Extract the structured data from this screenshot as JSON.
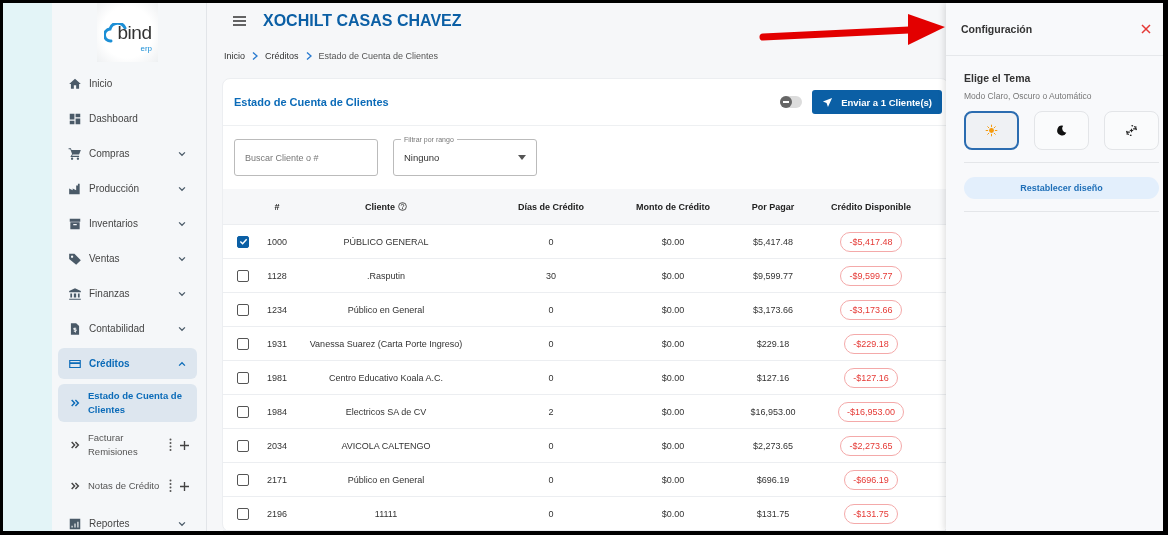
{
  "logo": {
    "name": "bind",
    "suffix": "erp"
  },
  "sidebar": {
    "items": [
      {
        "label": "Inicio",
        "kind": "link",
        "selected": false
      },
      {
        "label": "Dashboard",
        "kind": "link",
        "selected": false
      },
      {
        "label": "Compras",
        "kind": "group",
        "expanded": false,
        "selected": false
      },
      {
        "label": "Producción",
        "kind": "group",
        "expanded": false,
        "selected": false
      },
      {
        "label": "Inventarios",
        "kind": "group",
        "expanded": false,
        "selected": false
      },
      {
        "label": "Ventas",
        "kind": "group",
        "expanded": false,
        "selected": false
      },
      {
        "label": "Finanzas",
        "kind": "group",
        "expanded": false,
        "selected": false
      },
      {
        "label": "Contabilidad",
        "kind": "group",
        "expanded": false,
        "selected": false
      },
      {
        "label": "Créditos",
        "kind": "group",
        "expanded": true,
        "selected": true,
        "children": [
          {
            "label": "Estado de Cuenta de Clientes",
            "selected": true,
            "has_actions": false
          },
          {
            "label": "Facturar Remisiones",
            "selected": false,
            "has_actions": true
          },
          {
            "label": "Notas de Crédito",
            "selected": false,
            "has_actions": true
          }
        ]
      },
      {
        "label": "Reportes",
        "kind": "group",
        "expanded": false,
        "selected": false
      }
    ]
  },
  "header": {
    "title": "XOCHILT CASAS CHAVEZ"
  },
  "breadcrumb": [
    "Inicio",
    "Créditos",
    "Estado de Cuenta de Clientes"
  ],
  "card": {
    "title": "Estado de Cuenta de Clientes",
    "toggle": {
      "on": false
    },
    "send_button": "Enviar a 1 Cliente(s)",
    "search": {
      "placeholder": "Buscar Cliente o #"
    },
    "filter": {
      "label": "Filtrar por rango",
      "value": "Ninguno"
    }
  },
  "table": {
    "columns": [
      {
        "label": "#",
        "help": false
      },
      {
        "label": "Cliente",
        "help": true
      },
      {
        "label": "Días de Crédito",
        "help": false
      },
      {
        "label": "Monto de Crédito",
        "help": false
      },
      {
        "label": "Por Pagar",
        "help": false
      },
      {
        "label": "Crédito Disponible",
        "help": false
      }
    ],
    "rows": [
      {
        "checked": true,
        "cells": [
          "1000",
          "PÚBLICO GENERAL",
          "0",
          "$0.00",
          "$5,417.48",
          "-$5,417.48"
        ]
      },
      {
        "checked": false,
        "cells": [
          "1128",
          ".Rasputin",
          "30",
          "$0.00",
          "$9,599.77",
          "-$9,599.77"
        ]
      },
      {
        "checked": false,
        "cells": [
          "1234",
          "Público en General",
          "0",
          "$0.00",
          "$3,173.66",
          "-$3,173.66"
        ]
      },
      {
        "checked": false,
        "cells": [
          "1931",
          "Vanessa Suarez (Carta Porte Ingreso)",
          "0",
          "$0.00",
          "$229.18",
          "-$229.18"
        ]
      },
      {
        "checked": false,
        "cells": [
          "1981",
          "Centro Educativo Koala A.C.",
          "0",
          "$0.00",
          "$127.16",
          "-$127.16"
        ]
      },
      {
        "checked": false,
        "cells": [
          "1984",
          "Electricos SA de CV",
          "2",
          "$0.00",
          "$16,953.00",
          "-$16,953.00"
        ]
      },
      {
        "checked": false,
        "cells": [
          "2034",
          "AVICOLA CALTENGO",
          "0",
          "$0.00",
          "$2,273.65",
          "-$2,273.65"
        ]
      },
      {
        "checked": false,
        "cells": [
          "2171",
          "Público en General",
          "0",
          "$0.00",
          "$696.19",
          "-$696.19"
        ]
      },
      {
        "checked": false,
        "cells": [
          "2196",
          "11111",
          "0",
          "$0.00",
          "$131.75",
          "-$131.75"
        ]
      }
    ]
  },
  "config_panel": {
    "title": "Configuración",
    "theme_title": "Elige el Tema",
    "theme_subtitle": "Modo Claro, Oscuro o Automático",
    "themes": [
      {
        "kind": "light",
        "selected": true
      },
      {
        "kind": "dark",
        "selected": false
      },
      {
        "kind": "auto",
        "selected": false
      }
    ],
    "reset_button": "Restablecer diseño"
  }
}
